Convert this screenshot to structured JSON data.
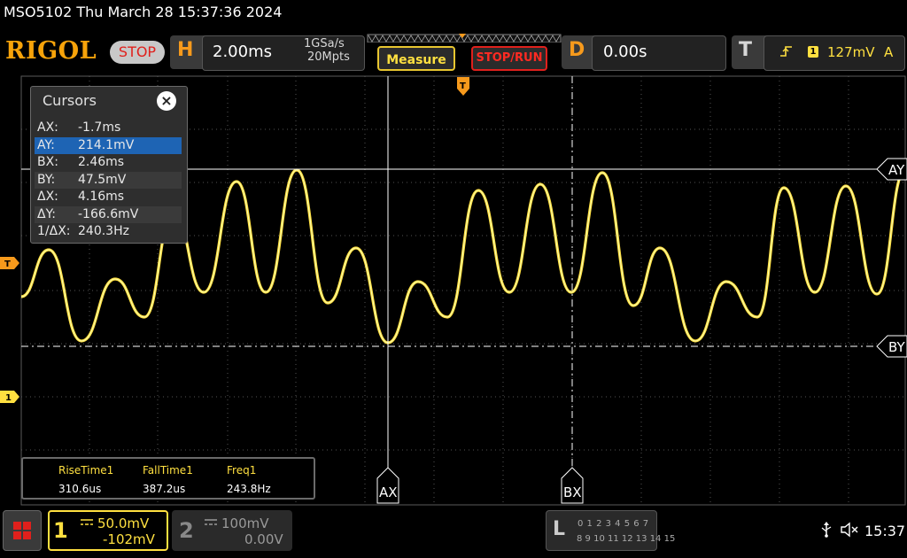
{
  "title": "MSO5102  Thu March 28 15:37:36 2024",
  "logo": "RIGOL",
  "run_state": "STOP",
  "horizontal": {
    "letter": "H",
    "time_base": "2.00ms",
    "sample_rate": "1GSa/s",
    "memory_depth": "20Mpts"
  },
  "buttons": {
    "measure": "Measure",
    "stop_run": "STOP/RUN"
  },
  "delay": {
    "letter": "D",
    "value": "0.00s"
  },
  "trigger": {
    "letter": "T",
    "source": "1",
    "level": "127mV",
    "mode": "A",
    "edge_icon": "rising-edge-icon"
  },
  "cursors": {
    "title": "Cursors",
    "rows": [
      {
        "key": "AX:",
        "value": "-1.7ms"
      },
      {
        "key": "AY:",
        "value": "214.1mV"
      },
      {
        "key": "BX:",
        "value": "2.46ms"
      },
      {
        "key": "BY:",
        "value": "47.5mV"
      },
      {
        "key": "ΔX:",
        "value": "4.16ms"
      },
      {
        "key": "ΔY:",
        "value": "-166.6mV"
      },
      {
        "key": "1/ΔX:",
        "value": "240.3Hz"
      }
    ],
    "selected_row": 1,
    "tags": {
      "ax": "AX",
      "bx": "BX",
      "ay": "AY",
      "by": "BY"
    }
  },
  "markers": {
    "trigger_level": "T",
    "ch1_ground": "1"
  },
  "measurements": [
    {
      "label": "RiseTime1",
      "value": "310.6us"
    },
    {
      "label": "FallTime1",
      "value": "387.2us"
    },
    {
      "label": "Freq1",
      "value": "243.8Hz"
    }
  ],
  "channels": {
    "ch1": {
      "number": "1",
      "scale": "50.0mV",
      "offset": "-102mV",
      "color": "#ffe040"
    },
    "ch2": {
      "number": "2",
      "scale": "100mV",
      "offset": "0.00V",
      "color": "#999999"
    }
  },
  "logic_analyzer": {
    "letter": "L",
    "row1": "0 1 2 3   4 5 6 7",
    "row2": "8  9 10 11  12 13 14 15"
  },
  "clock": "15:37"
}
